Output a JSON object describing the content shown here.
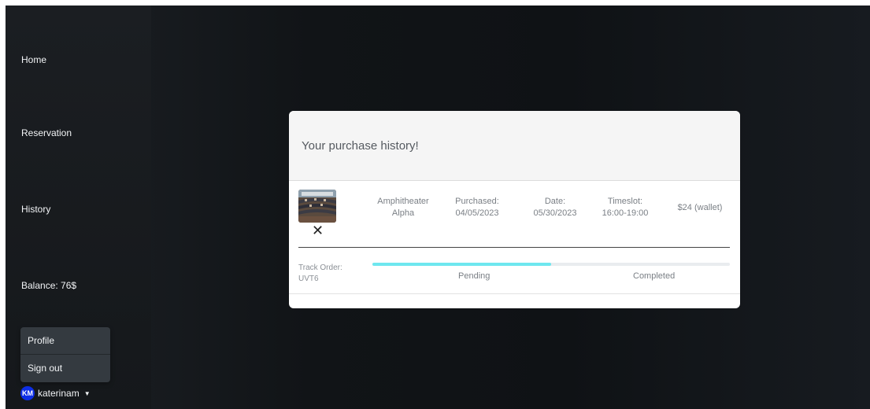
{
  "sidebar": {
    "items": [
      {
        "label": "Home"
      },
      {
        "label": "Reservation"
      },
      {
        "label": "History"
      },
      {
        "label": "Balance: 76$"
      }
    ],
    "dropdown": {
      "items": [
        {
          "label": "Profile"
        },
        {
          "label": "Sign out"
        }
      ]
    },
    "user": {
      "initials": "KM",
      "username": "katerinam",
      "caret": "▼"
    }
  },
  "modal": {
    "title": "Your purchase history!",
    "purchase": {
      "venue": "Amphitheater Alpha",
      "purchased": "Purchased: 04/05/2023",
      "date": "Date: 05/30/2023",
      "timeslot": "Timeslot: 16:00-19:00",
      "price": "$24 (wallet)",
      "remove_symbol": "✕"
    },
    "tracking": {
      "label": "Track Order: UVT6",
      "progress": 0.5,
      "status_pending": "Pending",
      "status_completed": "Completed"
    }
  },
  "colors": {
    "avatar": "#0d2ee6",
    "progress_fill": "#6ee7ef",
    "progress_track": "#e9ecef"
  }
}
